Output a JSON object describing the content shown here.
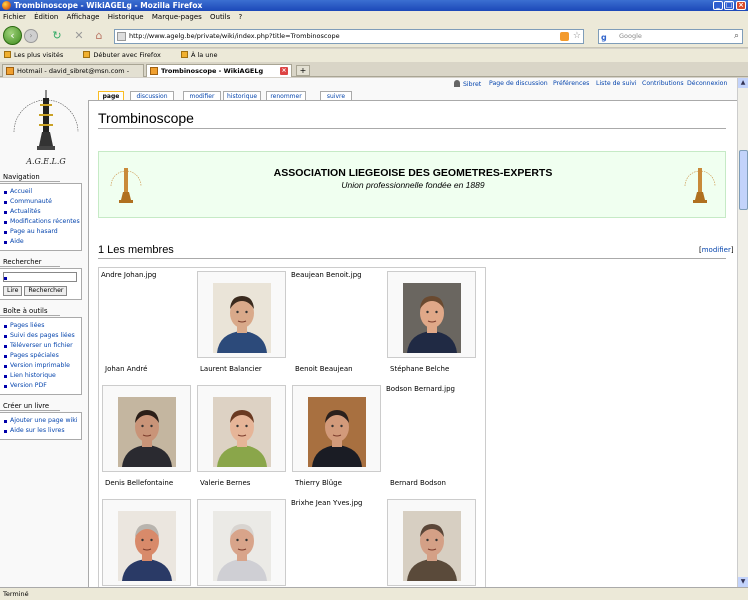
{
  "window": {
    "title": "Trombinoscope - WikiAGELg - Mozilla Firefox"
  },
  "menu": [
    "Fichier",
    "Édition",
    "Affichage",
    "Historique",
    "Marque-pages",
    "Outils",
    "?"
  ],
  "nav": {
    "url": "http://www.agelg.be/private/wiki/index.php?title=Trombinoscope",
    "search_placeholder": "Google"
  },
  "bookmarks": [
    "Les plus visités",
    "Débuter avec Firefox",
    "À la une"
  ],
  "browser_tabs": [
    {
      "label": "Hotmail - david_sibret@msn.com - Win..."
    },
    {
      "label": "Trombinoscope - WikiAGELg"
    }
  ],
  "personal": [
    "Sibret",
    "Page de discussion",
    "Préférences",
    "Liste de suivi",
    "Contributions",
    "Déconnexion"
  ],
  "content_tabs": [
    "page",
    "discussion",
    "modifier",
    "historique",
    "renommer",
    "suivre"
  ],
  "logo": {
    "text": "A.G.E.L.G"
  },
  "sidebar": {
    "navigation": {
      "title": "Navigation",
      "items": [
        "Accueil",
        "Communauté",
        "Actualités",
        "Modifications récentes",
        "Page au hasard",
        "Aide"
      ]
    },
    "search": {
      "title": "Rechercher",
      "btn_go": "Lire",
      "btn_search": "Rechercher"
    },
    "tools": {
      "title": "Boîte à outils",
      "items": [
        "Pages liées",
        "Suivi des pages liées",
        "Téléverser un fichier",
        "Pages spéciales",
        "Version imprimable",
        "Lien historique",
        "Version PDF"
      ]
    },
    "book": {
      "title": "Créer un livre",
      "items": [
        "Ajouter une page wiki",
        "Aide sur les livres"
      ]
    }
  },
  "page": {
    "title": "Trombinoscope",
    "assoc_title": "ASSOCIATION LIEGEOISE DES GEOMETRES-EXPERTS",
    "assoc_sub": "Union professionnelle fondée en 1889",
    "section": "1 Les membres",
    "edit": "modifier"
  },
  "gallery": [
    {
      "file": "Andre Johan.jpg",
      "caption": "Johan André",
      "photo": false
    },
    {
      "file": "",
      "caption": "Laurent Balancier",
      "photo": true,
      "skin": "#d9a98a",
      "hair": "#3a2a1e",
      "shirt": "#2c4a7a",
      "bg": "#eae4d8"
    },
    {
      "file": "Beaujean Benoit.jpg",
      "caption": "Benoit Beaujean",
      "photo": false
    },
    {
      "file": "",
      "caption": "Stéphane Belche",
      "photo": true,
      "skin": "#e0a888",
      "hair": "#6a4a30",
      "shirt": "#202a44",
      "bg": "#6a6660"
    },
    {
      "file": "",
      "caption": "Denis Bellefontaine",
      "photo": true,
      "skin": "#c99478",
      "hair": "#2a1e18",
      "shirt": "#2a2a30",
      "bg": "#c4b6a0"
    },
    {
      "file": "",
      "caption": "Valerie Bernes",
      "photo": true,
      "skin": "#e6b598",
      "hair": "#6a3a22",
      "shirt": "#8aa64a",
      "bg": "#ddd2c4"
    },
    {
      "file": "",
      "caption": "Thierry Blüge",
      "photo": true,
      "skin": "#d29a7a",
      "hair": "#2a201c",
      "shirt": "#1a1c24",
      "bg": "#a87040"
    },
    {
      "file": "Bodson Bernard.jpg",
      "caption": "Bernard Bodson",
      "photo": false
    },
    {
      "file": "",
      "caption": "",
      "photo": true,
      "skin": "#d88a6a",
      "hair": "#b8b4ae",
      "shirt": "#2a3a66",
      "bg": "#ebe6df"
    },
    {
      "file": "",
      "caption": "",
      "photo": true,
      "skin": "#d8a48a",
      "hair": "#d8d4d0",
      "shirt": "#cfcfd4",
      "bg": "#ebeae6"
    },
    {
      "file": "Brixhe Jean Yves.jpg",
      "caption": "",
      "photo": false
    },
    {
      "file": "",
      "caption": "",
      "photo": true,
      "skin": "#d4a086",
      "hair": "#5a4638",
      "shirt": "#5a4a3a",
      "bg": "#d7cfc2"
    }
  ],
  "status": "Terminé"
}
